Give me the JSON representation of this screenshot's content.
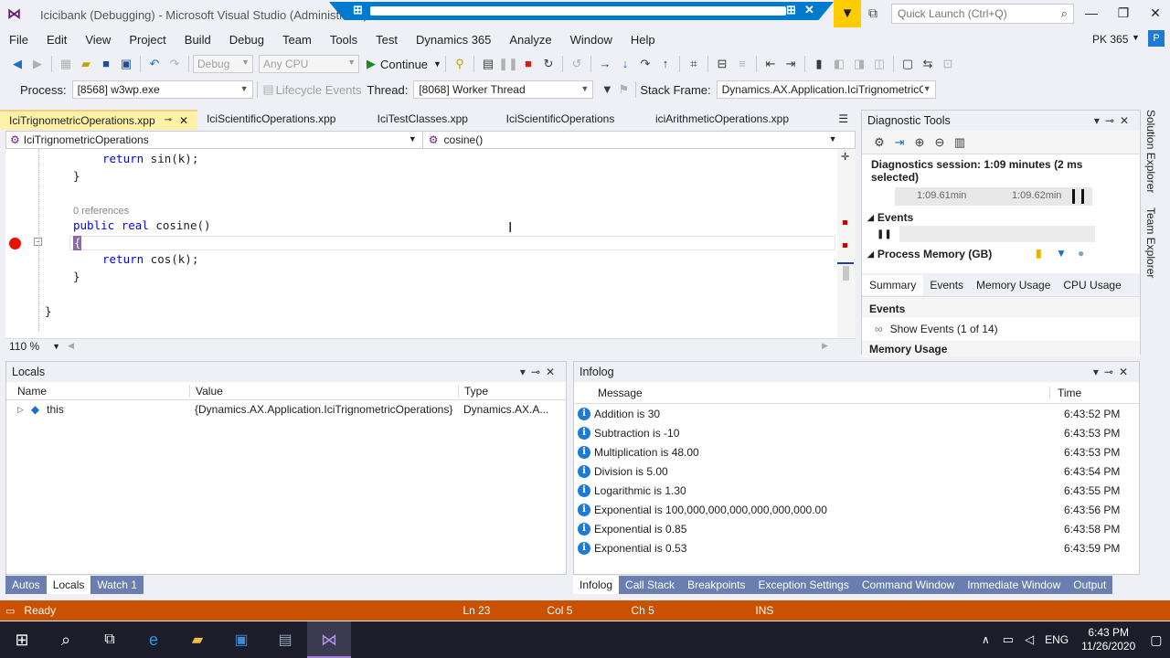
{
  "titlebar": {
    "text": "Icicibank (Debugging) - Microsoft Visual Studio (Administrator)",
    "quick_launch": "Quick Launch (Ctrl+Q)"
  },
  "menu": [
    "File",
    "Edit",
    "View",
    "Project",
    "Build",
    "Debug",
    "Team",
    "Tools",
    "Test",
    "Dynamics 365",
    "Analyze",
    "Window",
    "Help"
  ],
  "user": {
    "name": "PK 365",
    "initial": "P"
  },
  "toolbar": {
    "config": "Debug",
    "platform": "Any CPU",
    "continue": "Continue"
  },
  "debugbar": {
    "process_label": "Process:",
    "process": "[8568] w3wp.exe",
    "lifecycle": "Lifecycle Events",
    "thread_label": "Thread:",
    "thread": "[8068] Worker Thread",
    "stack_label": "Stack Frame:",
    "stack": "Dynamics.AX.Application.IciTrignometricO"
  },
  "editor": {
    "tabs": [
      "IciTrignometricOperations.xpp",
      "IciScientificOperations.xpp",
      "IciTestClasses.xpp",
      "IciScientificOperations",
      "iciArithmeticOperations.xpp"
    ],
    "nav_left": "IciTrignometricOperations",
    "nav_right": "cosine()",
    "zoom": "110 %",
    "code": {
      "l1_kw": "return",
      "l1_rest": " sin(k);",
      "l2": "}",
      "refs": "0 references",
      "l4_kw1": "public",
      "l4_kw2": "real",
      "l4_rest": " cosine()",
      "l5": "{",
      "l6_kw": "return",
      "l6_rest": " cos(k);",
      "l7": "}",
      "l8": "}"
    }
  },
  "diagnostics": {
    "title": "Diagnostic Tools",
    "session": "Diagnostics session: 1:09 minutes (2 ms selected)",
    "t1": "1:09.61min",
    "t2": "1:09.62min",
    "events": "Events",
    "memory": "Process Memory (GB)",
    "tabs": [
      "Summary",
      "Events",
      "Memory Usage",
      "CPU Usage"
    ],
    "events_hdr": "Events",
    "show_events": "Show Events (1 of 14)",
    "memory_usage": "Memory Usage"
  },
  "side_tabs": [
    "Solution Explorer",
    "Team Explorer"
  ],
  "locals": {
    "title": "Locals",
    "cols": [
      "Name",
      "Value",
      "Type"
    ],
    "row": {
      "name": "this",
      "value": "{Dynamics.AX.Application.IciTrignometricOperations}",
      "type": "Dynamics.AX.A..."
    },
    "bottom_tabs": [
      "Autos",
      "Locals",
      "Watch 1"
    ]
  },
  "infolog": {
    "title": "Infolog",
    "cols": [
      "Message",
      "Time"
    ],
    "rows": [
      {
        "msg": "Addition is 30",
        "time": "6:43:52 PM"
      },
      {
        "msg": "Subtraction is -10",
        "time": "6:43:53 PM"
      },
      {
        "msg": "Multiplication is 48.00",
        "time": "6:43:53 PM"
      },
      {
        "msg": "Division is 5.00",
        "time": "6:43:54 PM"
      },
      {
        "msg": "Logarithmic is 1.30",
        "time": "6:43:55 PM"
      },
      {
        "msg": "Exponential is 100,000,000,000,000,000,000.00",
        "time": "6:43:56 PM"
      },
      {
        "msg": "Exponential is 0.85",
        "time": "6:43:58 PM"
      },
      {
        "msg": "Exponential is 0.53",
        "time": "6:43:59 PM"
      }
    ],
    "bottom_tabs": [
      "Infolog",
      "Call Stack",
      "Breakpoints",
      "Exception Settings",
      "Command Window",
      "Immediate Window",
      "Output"
    ]
  },
  "status": {
    "ready": "Ready",
    "ln": "Ln 23",
    "col": "Col 5",
    "ch": "Ch 5",
    "ins": "INS"
  },
  "taskbar": {
    "lang": "ENG",
    "time": "6:43 PM",
    "date": "11/26/2020"
  },
  "colors": {
    "accent": "#007acc",
    "status": "#ca5100",
    "breakpoint": "#e51400"
  }
}
